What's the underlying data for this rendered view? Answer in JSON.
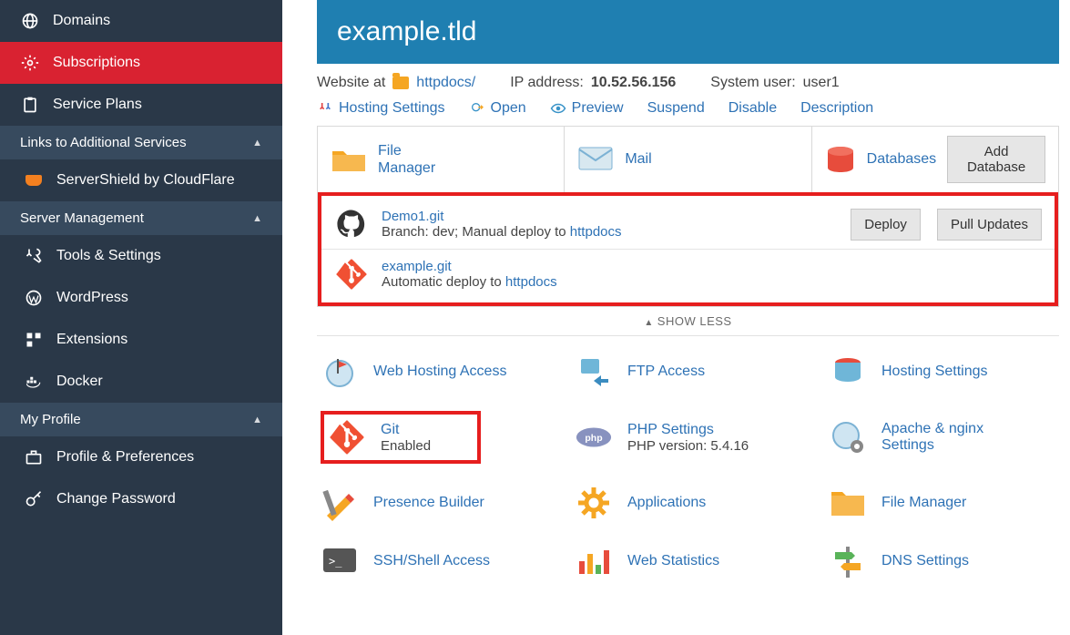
{
  "sidebar": {
    "items": [
      {
        "label": "Domains"
      },
      {
        "label": "Subscriptions"
      },
      {
        "label": "Service Plans"
      }
    ],
    "sections": [
      {
        "title": "Links to Additional Services",
        "items": [
          {
            "label": "ServerShield by CloudFlare"
          }
        ]
      },
      {
        "title": "Server Management",
        "items": [
          {
            "label": "Tools & Settings"
          },
          {
            "label": "WordPress"
          },
          {
            "label": "Extensions"
          },
          {
            "label": "Docker"
          }
        ]
      },
      {
        "title": "My Profile",
        "items": [
          {
            "label": "Profile & Preferences"
          },
          {
            "label": "Change Password"
          }
        ]
      }
    ]
  },
  "header": {
    "title": "example.tld",
    "website_prefix": "Website at",
    "docroot": "httpdocs/",
    "ip_label": "IP address:",
    "ip_value": "10.52.56.156",
    "sysuser_label": "System user:",
    "sysuser_value": "user1"
  },
  "quick_links": {
    "hosting": "Hosting Settings",
    "open": "Open",
    "preview": "Preview",
    "suspend": "Suspend",
    "disable": "Disable",
    "description": "Description"
  },
  "services": {
    "file_manager": "File\nManager",
    "mail": "Mail",
    "databases": "Databases",
    "add_db": "Add Database"
  },
  "repos": [
    {
      "name": "Demo1.git",
      "desc_prefix": "Branch: dev; Manual deploy to ",
      "desc_link": "httpdocs",
      "icon": "github",
      "deploy_btn": "Deploy",
      "pull_btn": "Pull Updates"
    },
    {
      "name": "example.git",
      "desc_prefix": "Automatic deploy to ",
      "desc_link": "httpdocs",
      "icon": "git"
    }
  ],
  "show_less": "SHOW LESS",
  "tiles": {
    "web_hosting_access": "Web Hosting Access",
    "ftp_access": "FTP Access",
    "hosting_settings": "Hosting Settings",
    "git": "Git",
    "git_status": "Enabled",
    "php_settings": "PHP Settings",
    "php_version": "PHP version: 5.4.16",
    "apache_nginx": "Apache & nginx Settings",
    "presence_builder": "Presence Builder",
    "applications": "Applications",
    "file_manager": "File Manager",
    "ssh": "SSH/Shell Access",
    "web_stats": "Web Statistics",
    "dns": "DNS Settings"
  }
}
